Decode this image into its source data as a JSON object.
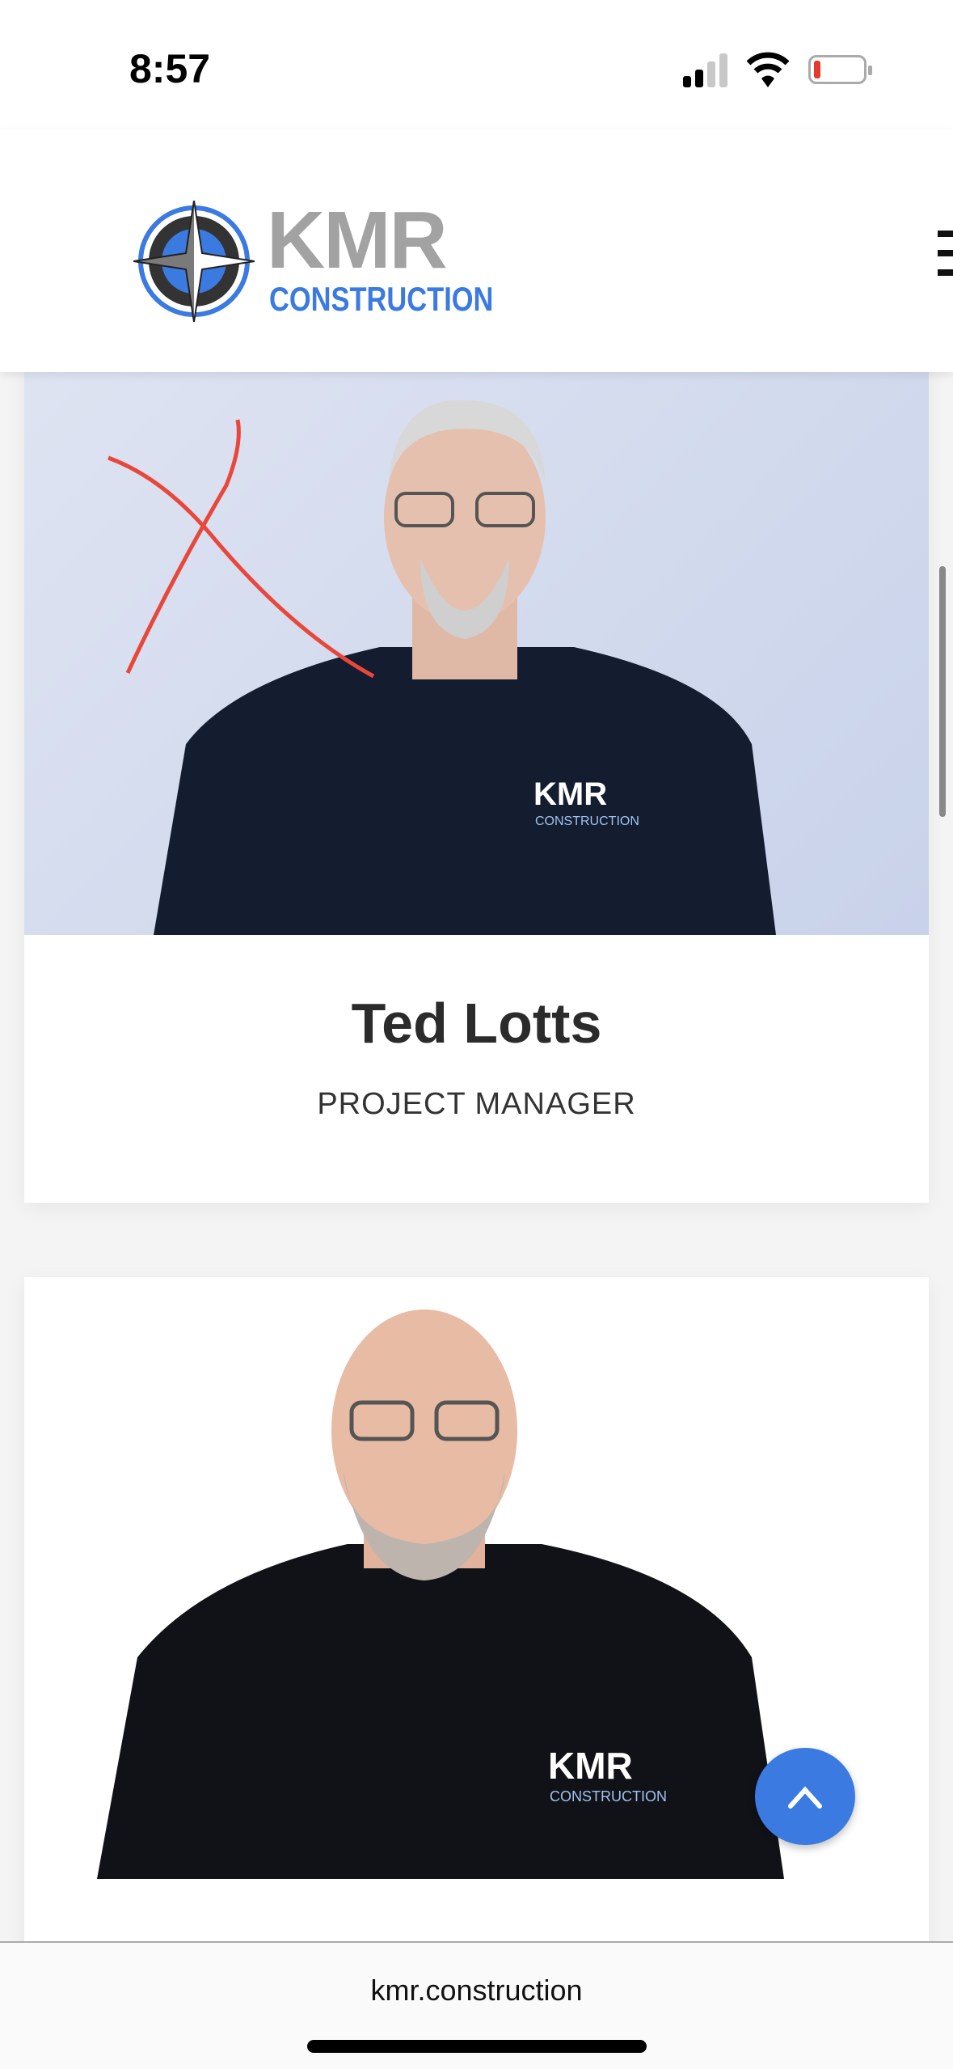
{
  "status_bar": {
    "time": "8:57",
    "battery_color": "#e53b2f"
  },
  "header": {
    "logo_text": "KMR",
    "logo_subtext": "CONSTRUCTION",
    "menu_icon": "hamburger-icon"
  },
  "team": [
    {
      "name": "Ted Lotts",
      "title": "PROJECT MANAGER",
      "shirt_logo": "KMR CONSTRUCTION",
      "annotation": "red-x"
    },
    {
      "name": "",
      "title": "",
      "shirt_logo": "KMR CONSTRUCTION"
    }
  ],
  "scroll_top_button": {
    "icon": "chevron-up-icon",
    "color": "#3b7ae0"
  },
  "browser": {
    "url": "kmr.construction"
  }
}
